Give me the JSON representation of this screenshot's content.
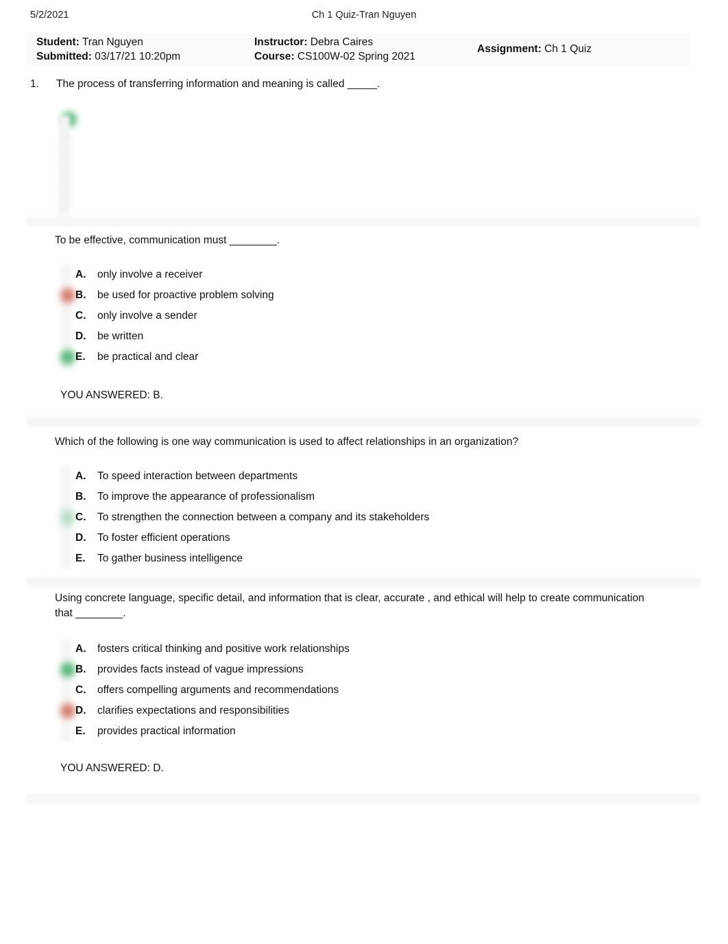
{
  "print_header": {
    "date": "5/2/2021",
    "doc_title": "Ch 1 Quiz-Tran Nguyen"
  },
  "info": {
    "student_label": "Student:",
    "student_value": " Tran Nguyen",
    "submitted_label": "Submitted:",
    "submitted_value": " 03/17/21 10:20pm",
    "instructor_label": "Instructor:",
    "instructor_value": " Debra Caires",
    "course_label": "Course:",
    "course_value": " CS100W-02 Spring 2021",
    "assignment_label": "Assignment:",
    "assignment_value": " Ch 1 Quiz"
  },
  "colors": {
    "correct_marker": "#3fae6a",
    "chosen_marker": "#d06a5a",
    "separator_band": "#f6f6f6",
    "info_band": "#fafafa"
  },
  "questions": [
    {
      "number": "1.",
      "stem": "The process of transferring information and meaning is called _____.",
      "answers_rendered": false,
      "answers": [],
      "you_answered": null
    },
    {
      "number": "",
      "stem": "To be effective, communication must ________.",
      "answers_rendered": true,
      "answers": [
        {
          "letter": "A.",
          "text": "only involve a receiver",
          "marker": "none"
        },
        {
          "letter": "B.",
          "text": "be used for proactive problem solving",
          "marker": "chosen"
        },
        {
          "letter": "C.",
          "text": "only involve a sender",
          "marker": "none"
        },
        {
          "letter": "D.",
          "text": "be written",
          "marker": "none"
        },
        {
          "letter": "E.",
          "text": "be practical and clear",
          "marker": "correct"
        }
      ],
      "you_answered": "YOU ANSWERED: B."
    },
    {
      "number": "",
      "stem": "Which of the following is one way communication is used to affect relationships in an organization?",
      "answers_rendered": true,
      "answers": [
        {
          "letter": "A.",
          "text": "To speed interaction between departments",
          "marker": "none"
        },
        {
          "letter": "B.",
          "text": "To improve the appearance of professionalism",
          "marker": "none"
        },
        {
          "letter": "C.",
          "text": "To strengthen the connection between a company and its stakeholders",
          "marker": "correct-faint"
        },
        {
          "letter": "D.",
          "text": "To foster efficient operations",
          "marker": "none"
        },
        {
          "letter": "E.",
          "text": "To gather business intelligence",
          "marker": "none"
        }
      ],
      "you_answered": null
    },
    {
      "number": "",
      "stem": "Using concrete language, specific detail, and information that is clear, accurate , and ethical will help to create communication that ________.",
      "answers_rendered": true,
      "answers": [
        {
          "letter": "A.",
          "text": "fosters critical thinking and positive work relationships",
          "marker": "none"
        },
        {
          "letter": "B.",
          "text": "provides facts instead of vague impressions",
          "marker": "correct"
        },
        {
          "letter": "C.",
          "text": "offers compelling arguments and recommendations",
          "marker": "none"
        },
        {
          "letter": "D.",
          "text": "clarifies expectations and responsibilities",
          "marker": "chosen"
        },
        {
          "letter": "E.",
          "text": "provides practical information",
          "marker": "none"
        }
      ],
      "you_answered": "YOU ANSWERED: D."
    }
  ]
}
